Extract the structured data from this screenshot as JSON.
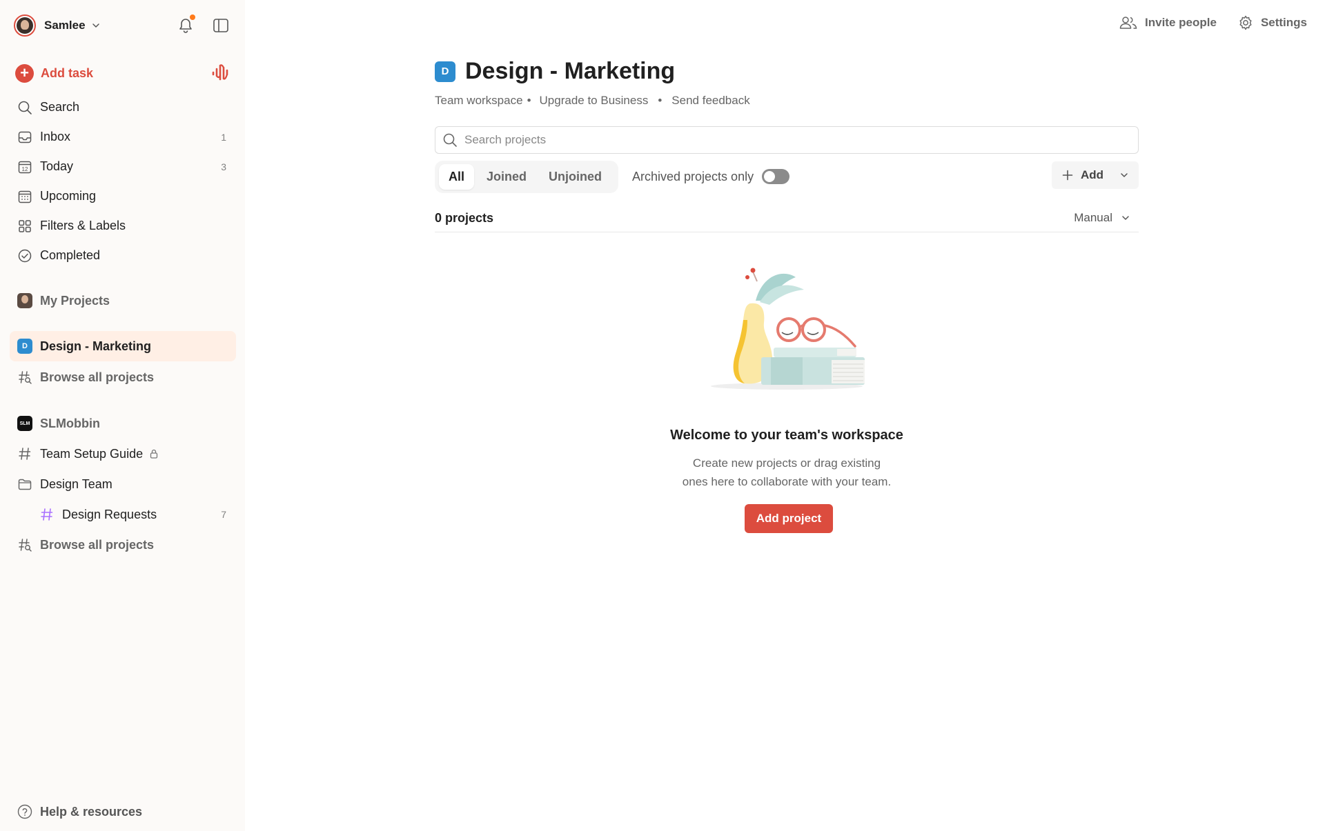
{
  "user": {
    "name": "Samlee"
  },
  "sidebar": {
    "add_task_label": "Add task",
    "nav": [
      {
        "label": "Search",
        "icon": "search-icon",
        "count": ""
      },
      {
        "label": "Inbox",
        "icon": "inbox-icon",
        "count": "1"
      },
      {
        "label": "Today",
        "icon": "calendar-today-icon",
        "count": "3"
      },
      {
        "label": "Upcoming",
        "icon": "calendar-grid-icon",
        "count": ""
      },
      {
        "label": "Filters & Labels",
        "icon": "filters-icon",
        "count": ""
      },
      {
        "label": "Completed",
        "icon": "check-circle-icon",
        "count": ""
      }
    ],
    "my_projects": "My Projects",
    "workspace1": {
      "badge": "D",
      "name": "Design - Marketing",
      "browse": "Browse all projects"
    },
    "workspace2": {
      "badge": "SLM",
      "name": "SLMobbin",
      "items": [
        {
          "label": "Team Setup Guide",
          "count": ""
        },
        {
          "label": "Design Team",
          "count": ""
        },
        {
          "label": "Design Requests",
          "count": "7"
        }
      ],
      "browse": "Browse all projects"
    },
    "help": "Help & resources"
  },
  "top": {
    "invite": "Invite people",
    "settings": "Settings"
  },
  "main": {
    "badge": "D",
    "title": "Design - Marketing",
    "meta": {
      "type": "Team workspace",
      "upgrade": "Upgrade to Business",
      "feedback": "Send feedback"
    },
    "search_placeholder": "Search projects",
    "tabs": [
      "All",
      "Joined",
      "Unjoined"
    ],
    "archived_label": "Archived projects only",
    "add_label": "Add",
    "count_label": "0 projects",
    "sort_label": "Manual",
    "empty": {
      "title": "Welcome to your team's workspace",
      "line1": "Create new projects or drag existing",
      "line2": "ones here to collaborate with your team.",
      "button": "Add project"
    }
  },
  "colors": {
    "accent": "#dc4c3e",
    "workspace_blue": "#2d8ccf",
    "active_bg": "#ffefe5",
    "sidebar_bg": "#fcfaf8"
  }
}
